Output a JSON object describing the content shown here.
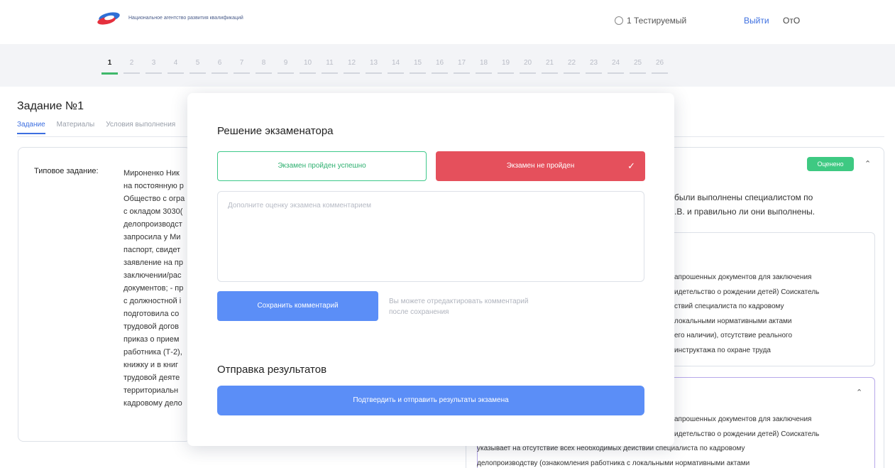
{
  "header": {
    "logo_text": "Национальное агентство развития квалификаций",
    "user_name": "1 Тестируемый",
    "logout_label": "Выйти",
    "toggle_label": "ОтО"
  },
  "steps": [
    "1",
    "2",
    "3",
    "4",
    "5",
    "6",
    "7",
    "8",
    "9",
    "10",
    "11",
    "12",
    "13",
    "14",
    "15",
    "16",
    "17",
    "18",
    "19",
    "20",
    "21",
    "22",
    "23",
    "24",
    "25",
    "26"
  ],
  "task": {
    "title": "Задание №1",
    "tabs": [
      {
        "label": "Задание"
      },
      {
        "label": "Материалы"
      },
      {
        "label": "Условия выполнения"
      }
    ],
    "typical_label": "Типовое задание:",
    "typical_text_lines": [
      "Мироненко Ник",
      "на постоянную р",
      "Общество с огра",
      "с окладом 3030(",
      "делопроизводст",
      "запросила у Ми",
      "паспорт, свидет",
      "заявление на пр",
      "заключении/рас",
      "документов; - пр",
      "с должностной і",
      "подготовила со",
      "трудовой догов",
      "приказ о прием",
      "работника (Т-2),",
      "книжку и в книг",
      "трудовой деяте",
      "территориальн",
      "кадровому дело"
    ]
  },
  "right_panel": {
    "badge": "Оценено",
    "question_lines": [
      "были выполнены специалистом по",
      ".В. и правильно ли они выполнены."
    ],
    "sub_card_lines": [
      "апрошенных документов для заключения",
      "идетельство о рождении детей) Соискатель",
      "ствий специалиста по кадровому",
      "локальными нормативными актами",
      "его наличии), отсутствие реального",
      "инструктажа по охране труда"
    ],
    "sub_card2_lines": [
      "апрошенных документов для заключения",
      "идетельство о рождении детей) Соискатель"
    ],
    "bottom_lines": [
      "указывает на отсутствие всех необходимых действий специалиста по кадровому",
      "делопроизводству (ознакомления работника с локальными нормативными актами"
    ]
  },
  "modal": {
    "decision_title": "Решение экзаменатора",
    "pass_label": "Экзамен пройден успешно",
    "fail_label": "Экзамен не пройден",
    "comment_placeholder": "Дополните оценку экзамена комментарием",
    "save_label": "Сохранить комментарий",
    "save_hint": "Вы можете отредактировать комментарий после сохранения",
    "submit_title": "Отправка результатов",
    "submit_label": "Подтвердить и отправить результаты экзамена"
  },
  "colors": {
    "accent_blue": "#5b8ef7",
    "fail_red": "#e5505c",
    "pass_green": "#3ec98a",
    "active_step": "#3fb86b"
  }
}
